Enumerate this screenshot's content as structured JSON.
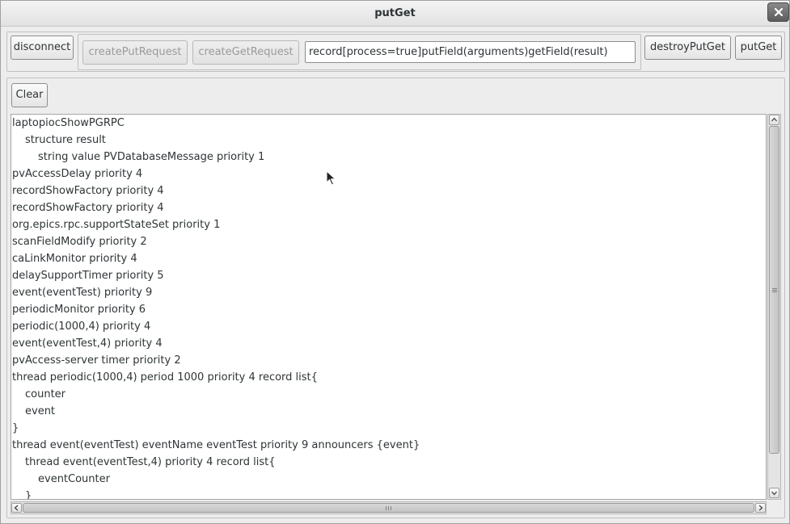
{
  "window": {
    "title": "putGet"
  },
  "toolbar": {
    "disconnect_label": "disconnect",
    "create_put_request_label": "createPutRequest",
    "create_get_request_label": "createGetRequest",
    "request_value": "record[process=true]putField(arguments)getField(result)",
    "destroy_put_get_label": "destroyPutGet",
    "put_get_label": "putGet"
  },
  "output": {
    "clear_label": "Clear",
    "lines": [
      {
        "indent": 0,
        "text": "laptopiocShowPGRPC"
      },
      {
        "indent": 1,
        "text": "structure result"
      },
      {
        "indent": 2,
        "text": "string value PVDatabaseMessage priority 1"
      },
      {
        "indent": 0,
        "text": "pvAccessDelay priority 4"
      },
      {
        "indent": 0,
        "text": "recordShowFactory priority 4"
      },
      {
        "indent": 0,
        "text": "recordShowFactory priority 4"
      },
      {
        "indent": 0,
        "text": "org.epics.rpc.supportStateSet priority 1"
      },
      {
        "indent": 0,
        "text": "scanFieldModify priority 2"
      },
      {
        "indent": 0,
        "text": "caLinkMonitor priority 4"
      },
      {
        "indent": 0,
        "text": "delaySupportTimer priority 5"
      },
      {
        "indent": 0,
        "text": "event(eventTest) priority 9"
      },
      {
        "indent": 0,
        "text": "periodicMonitor priority 6"
      },
      {
        "indent": 0,
        "text": "periodic(1000,4) priority 4"
      },
      {
        "indent": 0,
        "text": "event(eventTest,4) priority 4"
      },
      {
        "indent": 0,
        "text": "pvAccess-server timer priority 2"
      },
      {
        "indent": 0,
        "text": "thread periodic(1000,4) period 1000 priority 4 record list{"
      },
      {
        "indent": 1,
        "text": "counter"
      },
      {
        "indent": 1,
        "text": "event"
      },
      {
        "indent": 0,
        "text": "}"
      },
      {
        "indent": 0,
        "text": "thread event(eventTest) eventName eventTest priority 9 announcers {event}"
      },
      {
        "indent": 1,
        "text": "thread event(eventTest,4) priority 4 record list{"
      },
      {
        "indent": 2,
        "text": "eventCounter"
      },
      {
        "indent": 1,
        "text": "}"
      }
    ]
  },
  "icons": {
    "close": "close-icon",
    "scroll_up": "arrow-up-icon",
    "scroll_down": "arrow-down-icon",
    "scroll_left": "arrow-left-icon",
    "scroll_right": "arrow-right-icon",
    "pointer": "mouse-pointer-icon"
  }
}
